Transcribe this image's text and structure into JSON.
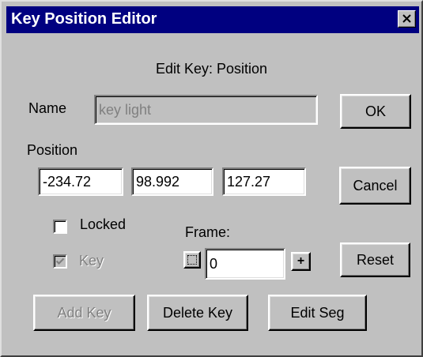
{
  "window": {
    "title": "Key Position Editor",
    "close_icon": "close-x-icon"
  },
  "header": {
    "edit_label": "Edit Key: Position"
  },
  "name_row": {
    "label": "Name",
    "value": "key light"
  },
  "position": {
    "label": "Position",
    "x": "-234.72",
    "y": "98.992",
    "z": "127.27"
  },
  "options": {
    "locked_label": "Locked",
    "locked_checked": false,
    "key_label": "Key",
    "key_checked": true
  },
  "frame": {
    "label": "Frame:",
    "value": "0",
    "plus_label": "+",
    "snap_icon": "frame-snap-icon"
  },
  "buttons": {
    "ok": "OK",
    "cancel": "Cancel",
    "reset": "Reset",
    "add_key": "Add Key",
    "delete_key": "Delete Key",
    "edit_seg": "Edit Seg"
  },
  "colors": {
    "titlebar": "#000080",
    "face": "#c0c0c0"
  }
}
